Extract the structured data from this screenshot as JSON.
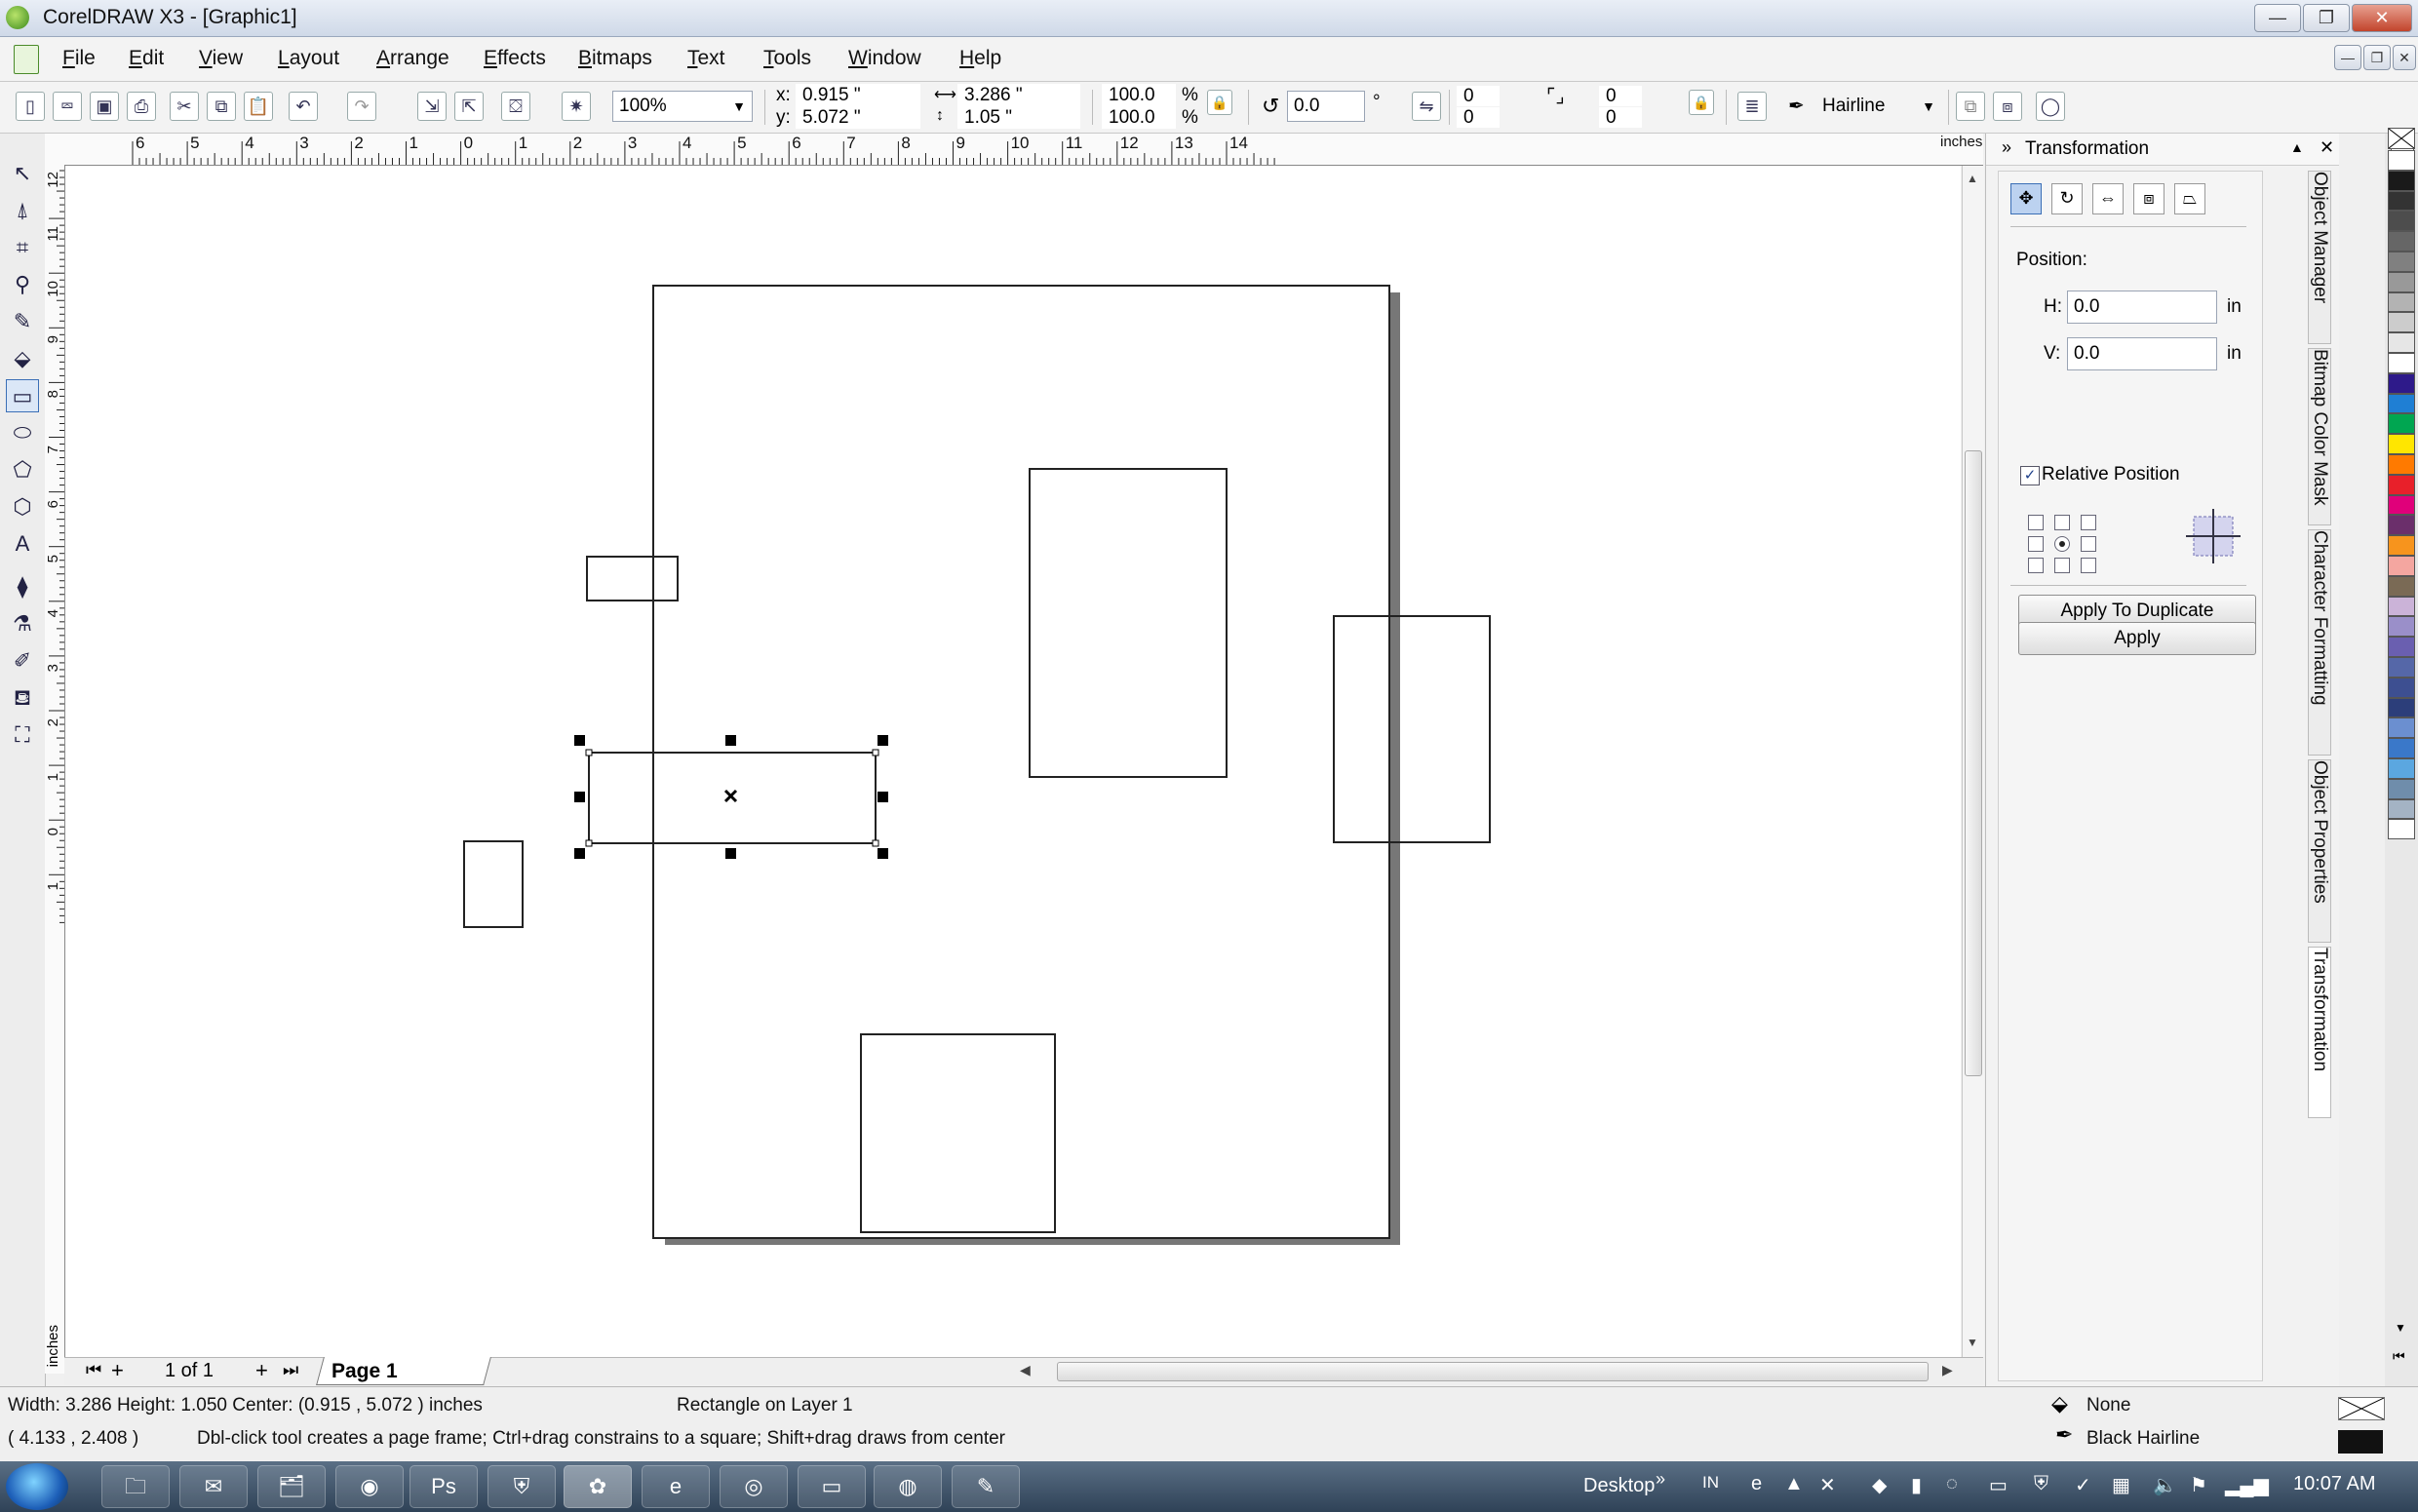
{
  "window": {
    "title": "CorelDRAW X3 - [Graphic1]",
    "minimize_label": "—",
    "restore_label": "❐",
    "close_label": "✕"
  },
  "menu": {
    "items": [
      {
        "label": "File"
      },
      {
        "label": "Edit"
      },
      {
        "label": "View"
      },
      {
        "label": "Layout"
      },
      {
        "label": "Arrange"
      },
      {
        "label": "Effects"
      },
      {
        "label": "Bitmaps"
      },
      {
        "label": "Text"
      },
      {
        "label": "Tools"
      },
      {
        "label": "Window"
      },
      {
        "label": "Help"
      }
    ]
  },
  "toolbar": {
    "zoom_value": "100%",
    "x_label": "x:",
    "x_value": "0.915 \"",
    "y_label": "y:",
    "y_value": "5.072 \"",
    "width_value": "3.286 \"",
    "height_value": "1.05 \"",
    "scale_x": "100.0",
    "scale_y": "100.0",
    "percent_sign": "%",
    "rotation_value": "0.0",
    "degree_sign": "°",
    "corner_tl": "0",
    "corner_bl": "0",
    "corner_tr": "0",
    "corner_br": "0",
    "outline_value": "Hairline"
  },
  "rulers": {
    "horizontal_ticks": [
      "6",
      "5",
      "4",
      "3",
      "2",
      "1",
      "0",
      "1",
      "2",
      "3",
      "4",
      "5",
      "6",
      "7",
      "8",
      "9",
      "10",
      "11",
      "12",
      "13",
      "14"
    ],
    "unit": "inches",
    "vertical_ticks": [
      "12",
      "11",
      "10",
      "9",
      "8",
      "7",
      "6",
      "5",
      "4",
      "3",
      "2",
      "1",
      "0",
      "1"
    ],
    "vertical_unit": "inches"
  },
  "page_nav": {
    "page_count": "1 of 1",
    "page_tab": "Page 1"
  },
  "docker": {
    "header": "Transformation",
    "position_label": "Position:",
    "h_label": "H:",
    "h_value": "0.0",
    "v_label": "V:",
    "v_value": "0.0",
    "unit": "in",
    "relative_position_label": "Relative Position",
    "apply_to_duplicate_label": "Apply To Duplicate",
    "apply_label": "Apply",
    "side_tabs": [
      "Object Manager",
      "Bitmap Color Mask",
      "Character Formatting",
      "Object Properties",
      "Transformation"
    ]
  },
  "palette": {
    "colors": [
      "#ffffff",
      "#1a1a1a",
      "#333333",
      "#4d4d4d",
      "#666666",
      "#808080",
      "#999999",
      "#b3b3b3",
      "#cccccc",
      "#e6e6e6",
      "#ffffff",
      "#2e1a8a",
      "#1f7fd4",
      "#00a651",
      "#ffe600",
      "#ff7a00",
      "#e8202a",
      "#e0007a",
      "#6b2f6b",
      "#f7941d",
      "#f4a6a0",
      "#7a6a55",
      "#cbb3d8",
      "#9a8fc9",
      "#6a5fb0",
      "#5567a8",
      "#3d4f91",
      "#2c3e7a",
      "#6b8fd0",
      "#3a78c9",
      "#5ba7e0",
      "#6f8dab",
      "#a4b3c4",
      "#ffffff"
    ]
  },
  "status": {
    "dimensions_text": "Width: 3.286  Height: 1.050  Center: (0.915 , 5.072 )  inches",
    "object_text": "Rectangle on Layer 1",
    "cursor_text": "( 4.133 , 2.408 )",
    "hint_text": "Dbl-click tool creates a page frame; Ctrl+drag constrains to a square; Shift+drag draws from center",
    "fill_label": "None",
    "outline_label": "Black  Hairline"
  },
  "taskbar": {
    "desktop_label": "Desktop",
    "lang_label": "IN",
    "clock": "10:07 AM"
  }
}
